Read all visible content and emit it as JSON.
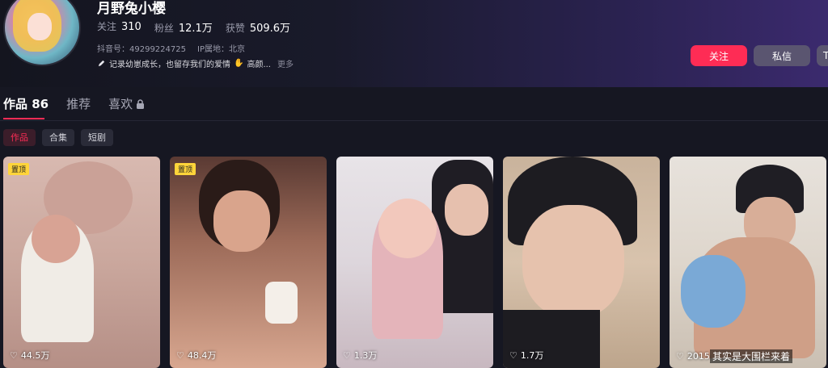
{
  "profile": {
    "name": "月野兔小樱",
    "stats": [
      {
        "label": "关注",
        "value": "310"
      },
      {
        "label": "粉丝",
        "value": "12.1万"
      },
      {
        "label": "获赞",
        "value": "509.6万"
      }
    ],
    "douyin_id": "抖音号：49299224725",
    "ip": "IP属地：北京",
    "bio": "记录幼崽成长，也留存我们的爱情",
    "bio_suffix": "高颜...",
    "more": "更多"
  },
  "actions": {
    "follow": "关注",
    "message": "私信",
    "more": "T"
  },
  "tabs": [
    {
      "label": "作品 86"
    },
    {
      "label": "推荐"
    },
    {
      "label": "喜欢"
    }
  ],
  "filters": [
    {
      "label": "作品"
    },
    {
      "label": "合集"
    },
    {
      "label": "短剧"
    }
  ],
  "videos": [
    {
      "pin": "置顶",
      "likes": "44.5万"
    },
    {
      "pin": "置顶",
      "likes": "48.4万"
    },
    {
      "likes": "1.3万"
    },
    {
      "likes": "1.7万"
    },
    {
      "likes": "2015",
      "caption": "其实是大围栏来着"
    }
  ],
  "colors": {
    "accent": "#fe2c55",
    "pin": "#ffd43a",
    "background": "#161722"
  }
}
